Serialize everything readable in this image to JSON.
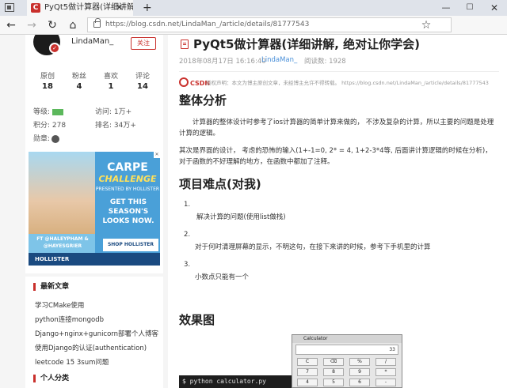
{
  "browser": {
    "tab_title": "PyQt5做计算器(详细讲解",
    "tab_close": "✕",
    "new_tab": "+",
    "url": "https://blog.csdn.net/LindaMan_/article/details/81777543",
    "back": "←",
    "forward": "→",
    "reload": "↻",
    "home": "⌂",
    "favorite": "☆",
    "win_min": "—",
    "win_max": "☐",
    "win_close": "✕"
  },
  "profile": {
    "username": "LindaMan_",
    "follow_label": "关注",
    "stats": [
      {
        "label": "原创",
        "value": "18"
      },
      {
        "label": "粉丝",
        "value": "4"
      },
      {
        "label": "喜欢",
        "value": "1"
      },
      {
        "label": "评论",
        "value": "14"
      }
    ],
    "level_label": "等级:",
    "visits_label": "访问:",
    "visits_value": "1万+",
    "points_label": "积分:",
    "points_value": "278",
    "rank_label": "排名:",
    "rank_value": "34万+",
    "medal_label": "勋章:"
  },
  "ad": {
    "carpe": "CARPE",
    "challenge": "CHALLENGE",
    "presented": "PRESENTED BY HOLLISTER",
    "copy": "GET THIS SEASON'S LOOKS NOW.",
    "shop": "SHOP HOLLISTER",
    "ft": "FT @HALEYPHAM & @HAYESGRIER",
    "brand": "HOLLISTER"
  },
  "recent": {
    "title": "最新文章",
    "items": [
      "学习CMake使用",
      "python连接mongodb",
      "Django+nginx+gunicorn部署个人博客",
      "使用Django的认证(authentication)",
      "leetcode 15 3sum问题"
    ]
  },
  "categories": {
    "title": "个人分类"
  },
  "article": {
    "title": "PyQt5做计算器(详细讲解, 绝对让你学会)",
    "date": "2018年08月17日 16:16:40",
    "author": "LindaMan_",
    "reads": "阅读数: 1928",
    "csdn": "CSDN",
    "copyright": "版权声明：本文为博主原创文章，未经博主允许不得转载。 https://blog.csdn.net/LindaMan_/article/details/81777543",
    "section1": "整体分析",
    "para1": "计算器的整体设计时参考了ios计算器的简单计算来做的， 不涉及复杂的计算，所以主要的问题是处理计算的逻辑。",
    "para2": "其次是界面的设计， 考虑的恐怖的输入(1+-1=0, 2* = 4, 1+2-3*4等, 后面讲计算逻辑的时候在分析)， 对于函数的不好理解的地方，在函数中都加了注释。",
    "section2": "项目难点(对我)",
    "list": [
      {
        "num": "1.",
        "text": "解决计算的问题(使用list做栈)"
      },
      {
        "num": "2.",
        "text": "对于何时清理屏幕的显示，不明这句，在接下来讲的时候，参考下手机里的计算"
      },
      {
        "num": "3.",
        "text": "小数点只能有一个"
      }
    ],
    "section3": "效果图",
    "terminal": "$ python calculator.py",
    "calc_title": "Calculator",
    "calc_display": "33",
    "calc_keys": [
      "C",
      "⌫",
      "%",
      "/",
      "7",
      "8",
      "9",
      "*",
      "4",
      "5",
      "6",
      "-"
    ]
  }
}
